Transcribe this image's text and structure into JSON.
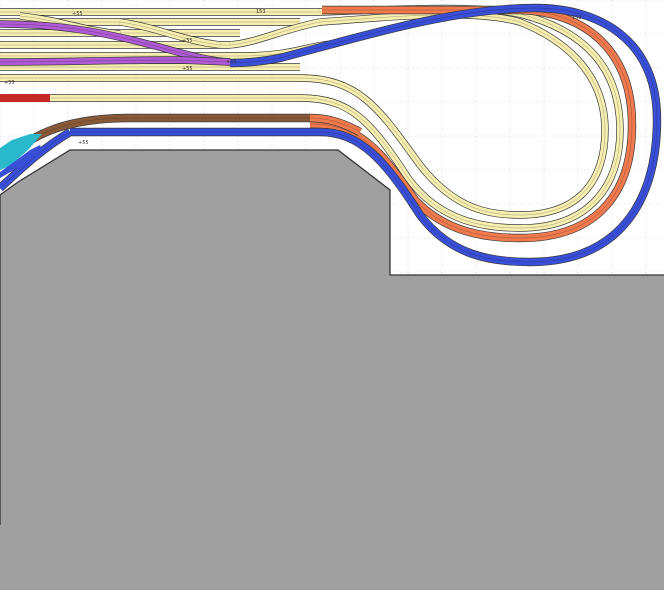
{
  "palette": {
    "background": "#ffffff",
    "grid": "#d9d9d9",
    "baseboard": "#a0a0a0",
    "baseboard_edge": "#333333",
    "track_yellow": "#f7efb0",
    "track_orange": "#f07a4e",
    "track_blue": "#3a4fd8",
    "track_purple": "#b05ad6",
    "track_brown": "#8a5a38",
    "track_red": "#c62a24",
    "track_teal": "#29b8cc",
    "rail": "#3a3a3a"
  },
  "labels": {
    "l1": "+55",
    "l2": "153",
    "l3": "+55",
    "l4": "+55",
    "l5": "+55",
    "l6": "159",
    "l7": "+55",
    "l8": "+55"
  }
}
